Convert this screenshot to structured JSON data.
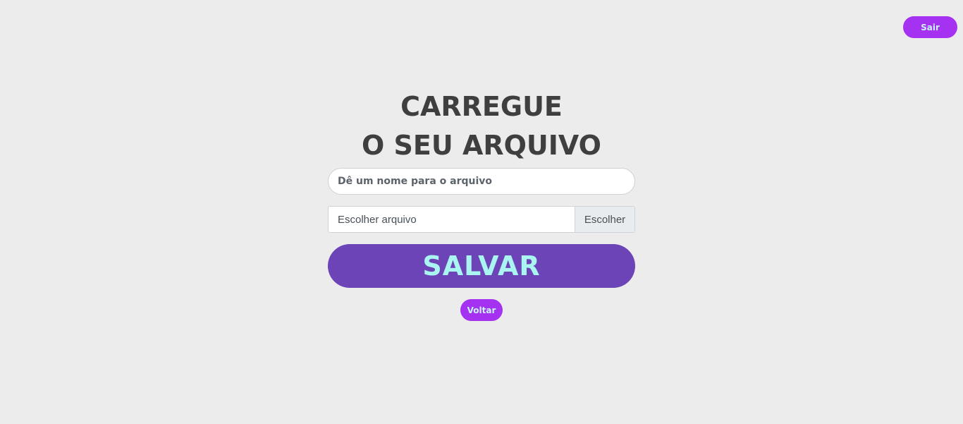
{
  "header": {
    "logout_label": "Sair"
  },
  "main": {
    "title_line1": "CARREGUE",
    "title_line2": "O SEU ARQUIVO",
    "name_field": {
      "placeholder": "Dê um nome para o arquivo",
      "value": ""
    },
    "file_field": {
      "label": "Escolher arquivo",
      "browse_label": "Escolher"
    },
    "save_label": "SALVAR",
    "back_label": "Voltar"
  },
  "colors": {
    "background": "#ebeceb",
    "accent_purple": "#a532f0",
    "save_purple": "#6c44b8",
    "button_text": "#aaf5f2",
    "title_text": "#3f3f3f"
  }
}
